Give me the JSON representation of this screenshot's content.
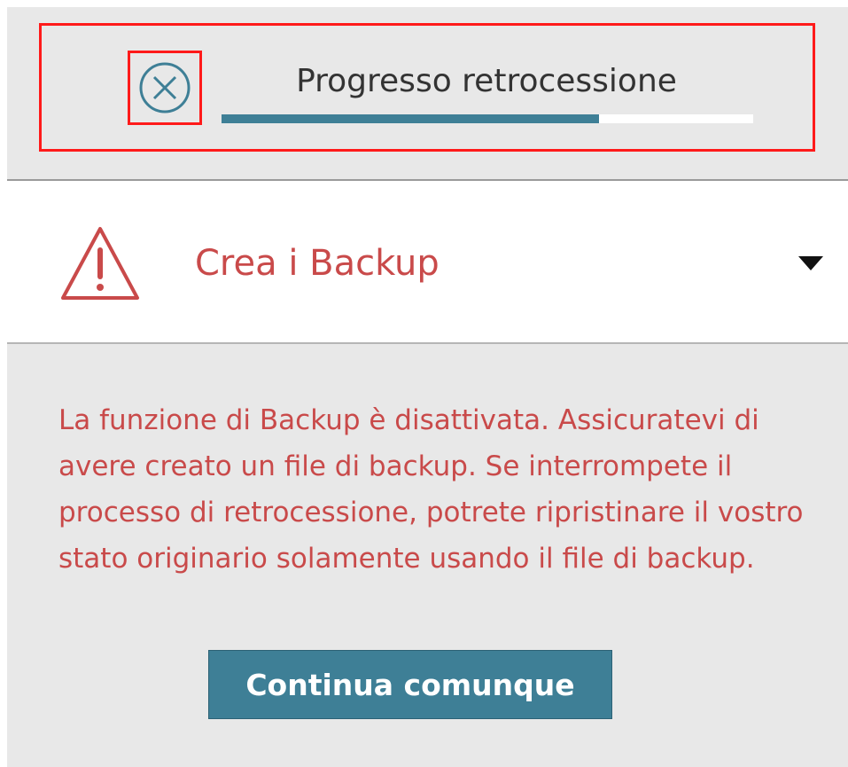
{
  "progress": {
    "title": "Progresso retrocessione",
    "value": 0.71,
    "cancel_icon": "circle-x-icon"
  },
  "backup_section": {
    "title": "Crea i Backup",
    "warning_icon": "warning-triangle-icon",
    "expand_icon": "triangle-down-icon",
    "message": "La funzione di Backup è disattivata. Assicuratevi di avere creato un file di backup. Se interrompete il processo di retrocessione, potrete ripristinare il vostro stato originario solamente usando il file di backup.",
    "continue_label": "Continua comunque"
  },
  "colors": {
    "accent": "#3e7f96",
    "warning": "#c94a4a",
    "highlight": "#ff1a1a",
    "panel_bg": "#e8e8e8"
  }
}
